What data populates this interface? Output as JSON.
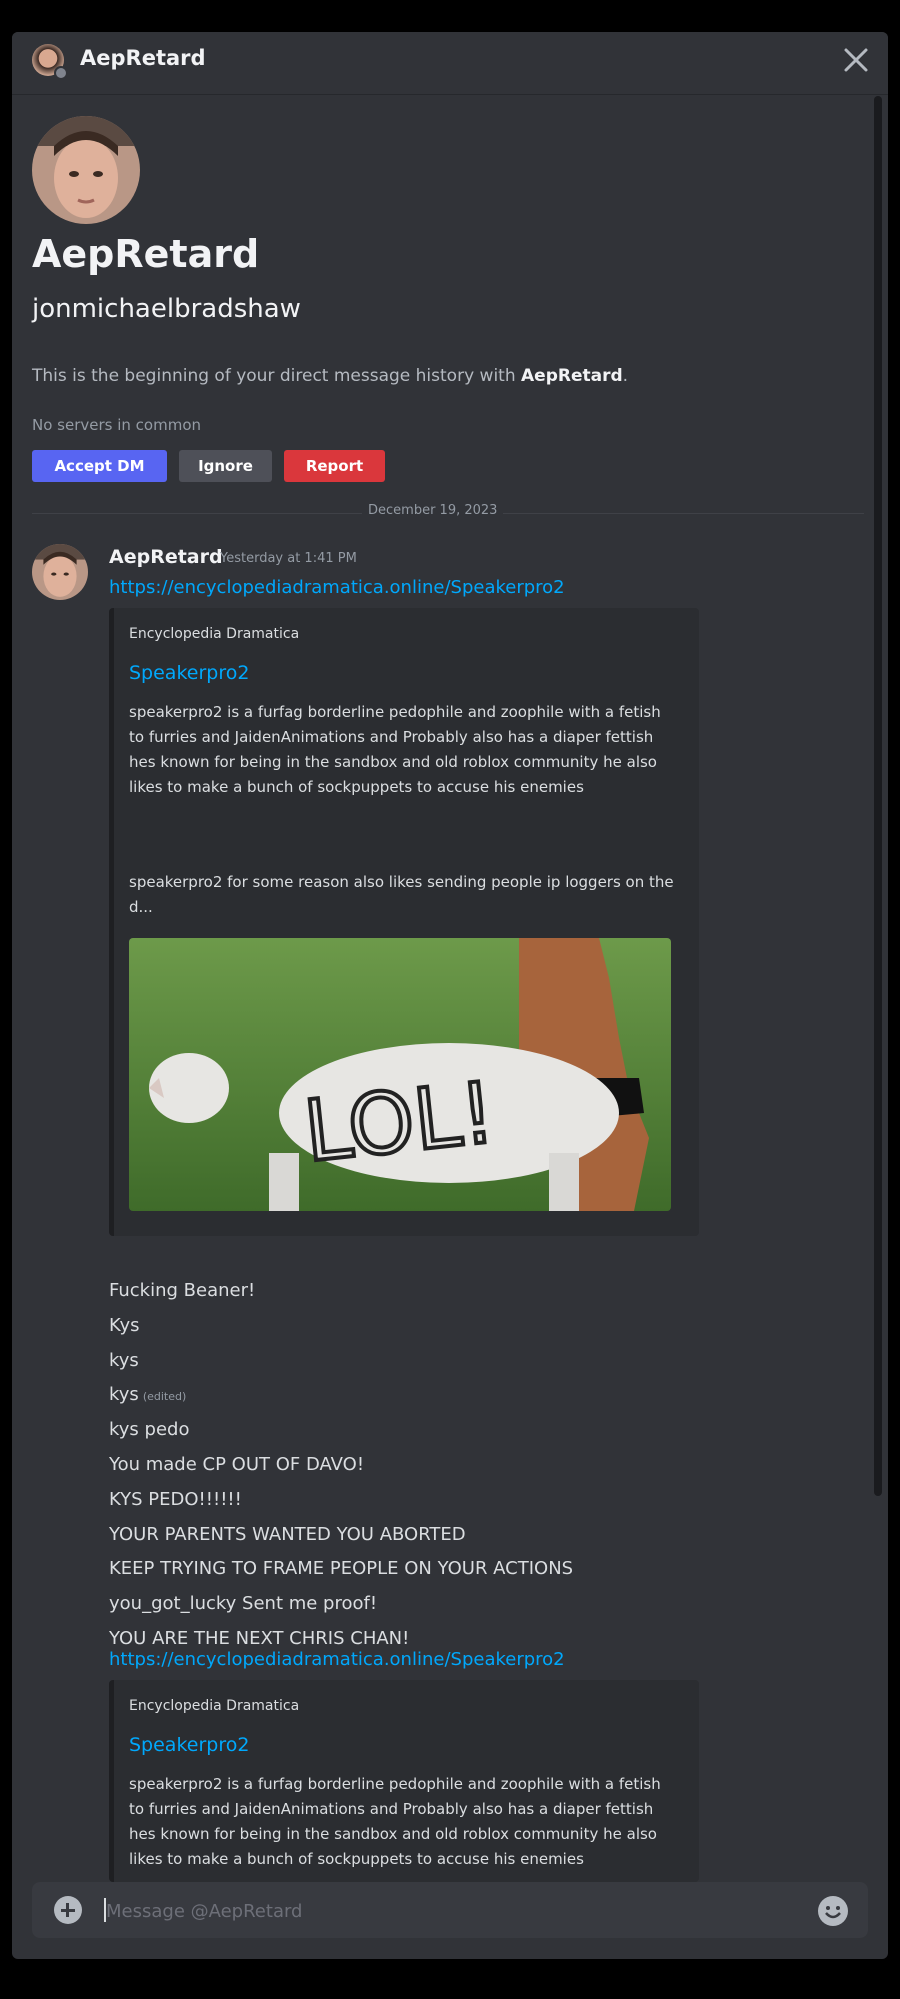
{
  "header": {
    "title": "AepRetard",
    "close_icon": "close-icon"
  },
  "intro": {
    "display_name": "AepRetard",
    "username": "jonmichaelbradshaw",
    "desc_prefix": "This is the beginning of your direct message history with ",
    "desc_name": "AepRetard",
    "desc_suffix": ".",
    "no_servers": "No servers in common",
    "buttons": {
      "accept": "Accept DM",
      "ignore": "Ignore",
      "report": "Report"
    }
  },
  "divider": {
    "date": "December 19, 2023"
  },
  "message": {
    "author": "AepRetard",
    "timestamp": "Yesterday at 1:41 PM",
    "link": "https://encyclopediadramatica.online/Speakerpro2",
    "embed": {
      "provider": "Encyclopedia Dramatica",
      "title": "Speakerpro2",
      "description": "speakerpro2 is a furfag borderline pedophile and zoophile with a fetish to furries and JaidenAnimations and Probably also has a diaper fettish hes known for being in the sandbox and old roblox community he also likes to make a bunch of sockpuppets to accuse his enemies",
      "description2": "speakerpro2 for some reason also likes sending people ip loggers on the d...",
      "image_text": "LOL!"
    },
    "lines": [
      {
        "text": "Fucking Beaner!"
      },
      {
        "text": "Kys"
      },
      {
        "text": "kys"
      },
      {
        "text": "kys",
        "edited": "(edited)"
      },
      {
        "text": "kys pedo"
      },
      {
        "text": "You made CP OUT OF DAVO!"
      },
      {
        "text": "KYS PEDO!!!!!!"
      },
      {
        "text": "YOUR PARENTS WANTED YOU ABORTED"
      },
      {
        "text": "KEEP TRYING TO FRAME PEOPLE ON YOUR ACTIONS"
      },
      {
        "text": "you_got_lucky Sent me proof!"
      },
      {
        "text": "YOU ARE THE NEXT CHRIS CHAN!"
      }
    ],
    "link2": "https://encyclopediadramatica.online/Speakerpro2",
    "embed2": {
      "provider": "Encyclopedia Dramatica",
      "title": "Speakerpro2",
      "description": "speakerpro2 is a furfag borderline pedophile and zoophile with a fetish to furries and JaidenAnimations and Probably also has a diaper fettish hes known for being in the sandbox and old roblox community he also likes to make a bunch of sockpuppets to accuse his enemies"
    }
  },
  "composer": {
    "placeholder": "Message @AepRetard"
  }
}
